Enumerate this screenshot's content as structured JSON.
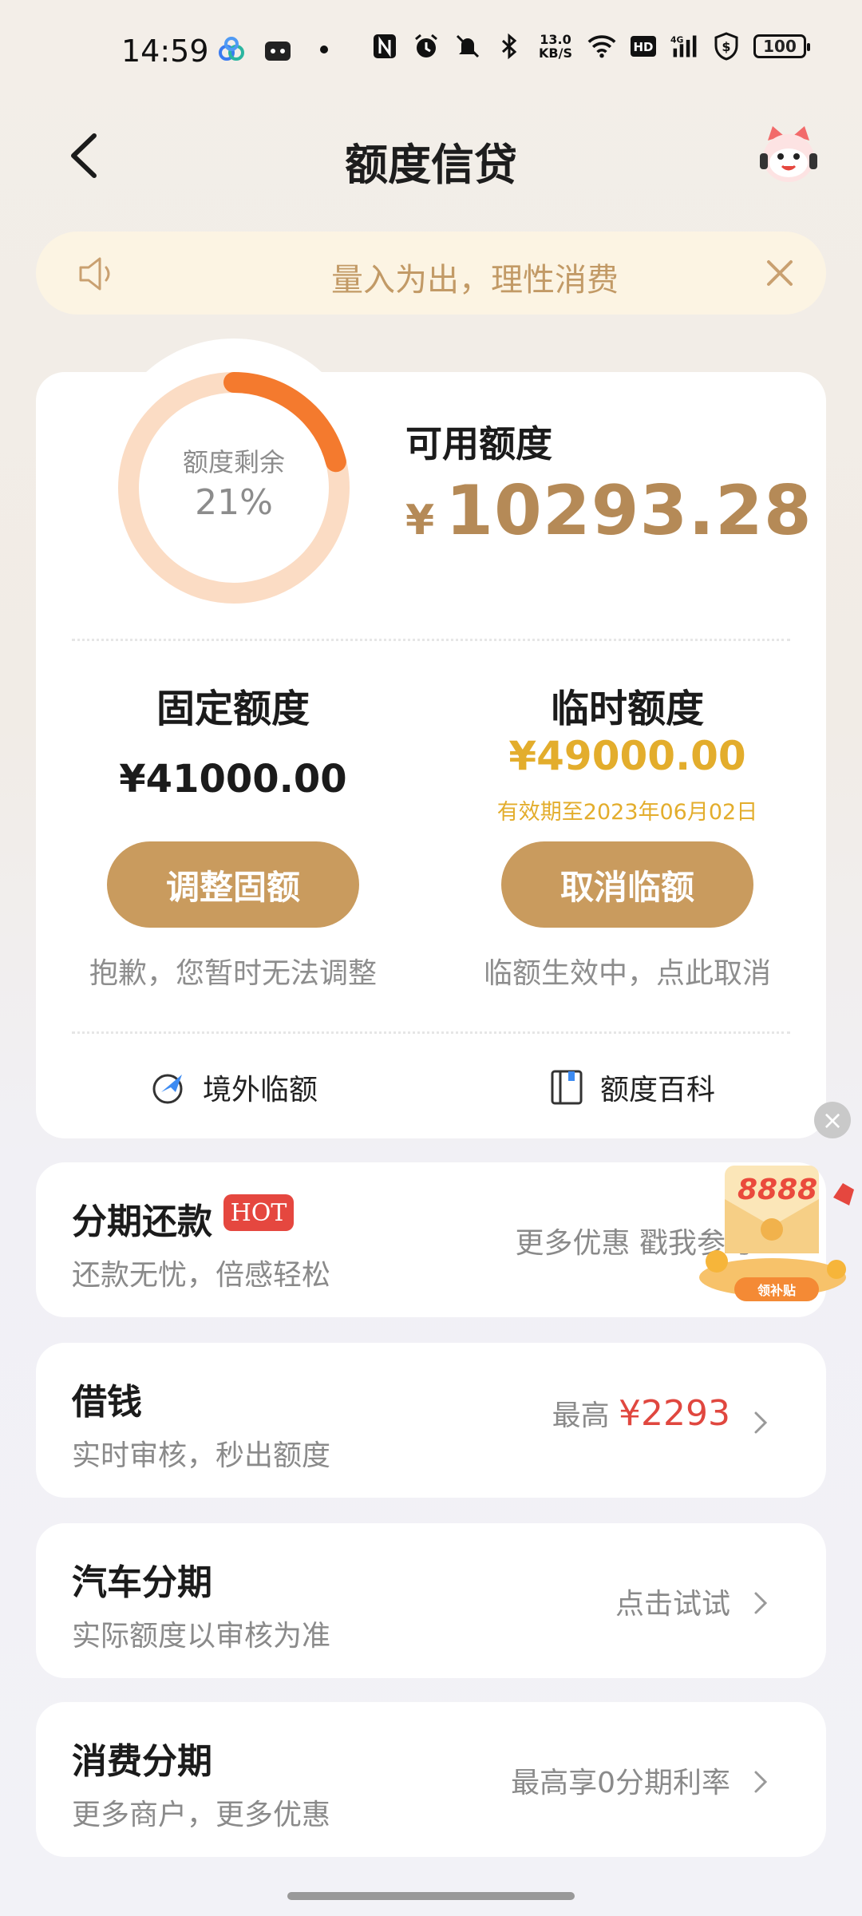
{
  "status_bar": {
    "time": "14:59",
    "net_speed_value": "13.0",
    "net_speed_unit": "KB/S",
    "hd_label": "HD",
    "signal_label": "4G",
    "battery": "100",
    "icons": [
      "app-icon-1",
      "app-icon-2",
      "dot-icon",
      "nfc-icon",
      "alarm-icon",
      "mute-icon",
      "bluetooth-icon",
      "wifi-icon",
      "hd-icon",
      "signal-icon",
      "shield-dollar-icon",
      "battery-icon"
    ]
  },
  "header": {
    "title": "额度信贷",
    "back_icon": "back-arrow-icon",
    "mascot_icon": "mascot-icon"
  },
  "notice": {
    "text": "量入为出，理性消费",
    "speaker_icon": "speaker-icon",
    "close_icon": "close-icon"
  },
  "credit": {
    "ring_label": "额度剩余",
    "ring_percent_text": "21%",
    "ring_fraction": 0.21,
    "available_label": "可用额度",
    "currency": "¥",
    "available_amount": "10293.28",
    "colors": {
      "ring_track": "#fbdcc4",
      "ring_fill": "#f47a2e",
      "amount": "#b58a57",
      "button": "#c99b5e",
      "temp_amount": "#e3ad2c"
    }
  },
  "fixed": {
    "title": "固定额度",
    "amount": "¥41000.00",
    "button": "调整固额",
    "note": "抱歉，您暂时无法调整"
  },
  "temp": {
    "title": "临时额度",
    "amount": "¥49000.00",
    "expiry": "有效期至2023年06月02日",
    "button": "取消临额",
    "note": "临额生效中，点此取消"
  },
  "links": {
    "overseas": "境外临额",
    "wiki": "额度百科"
  },
  "promo": {
    "badge": "8888",
    "tag": "领补贴"
  },
  "list": [
    {
      "title": "分期还款",
      "badge": "HOT",
      "sub": "还款无忧，倍感轻松",
      "right": "更多优惠 戳我参与"
    },
    {
      "title": "借钱",
      "sub": "实时审核，秒出额度",
      "right_prefix": "最高 ",
      "right_highlight": "¥2293"
    },
    {
      "title": "汽车分期",
      "sub": "实际额度以审核为准",
      "right": "点击试试"
    },
    {
      "title": "消费分期",
      "sub": "更多商户，更多优惠",
      "right": "最高享0分期利率"
    }
  ]
}
